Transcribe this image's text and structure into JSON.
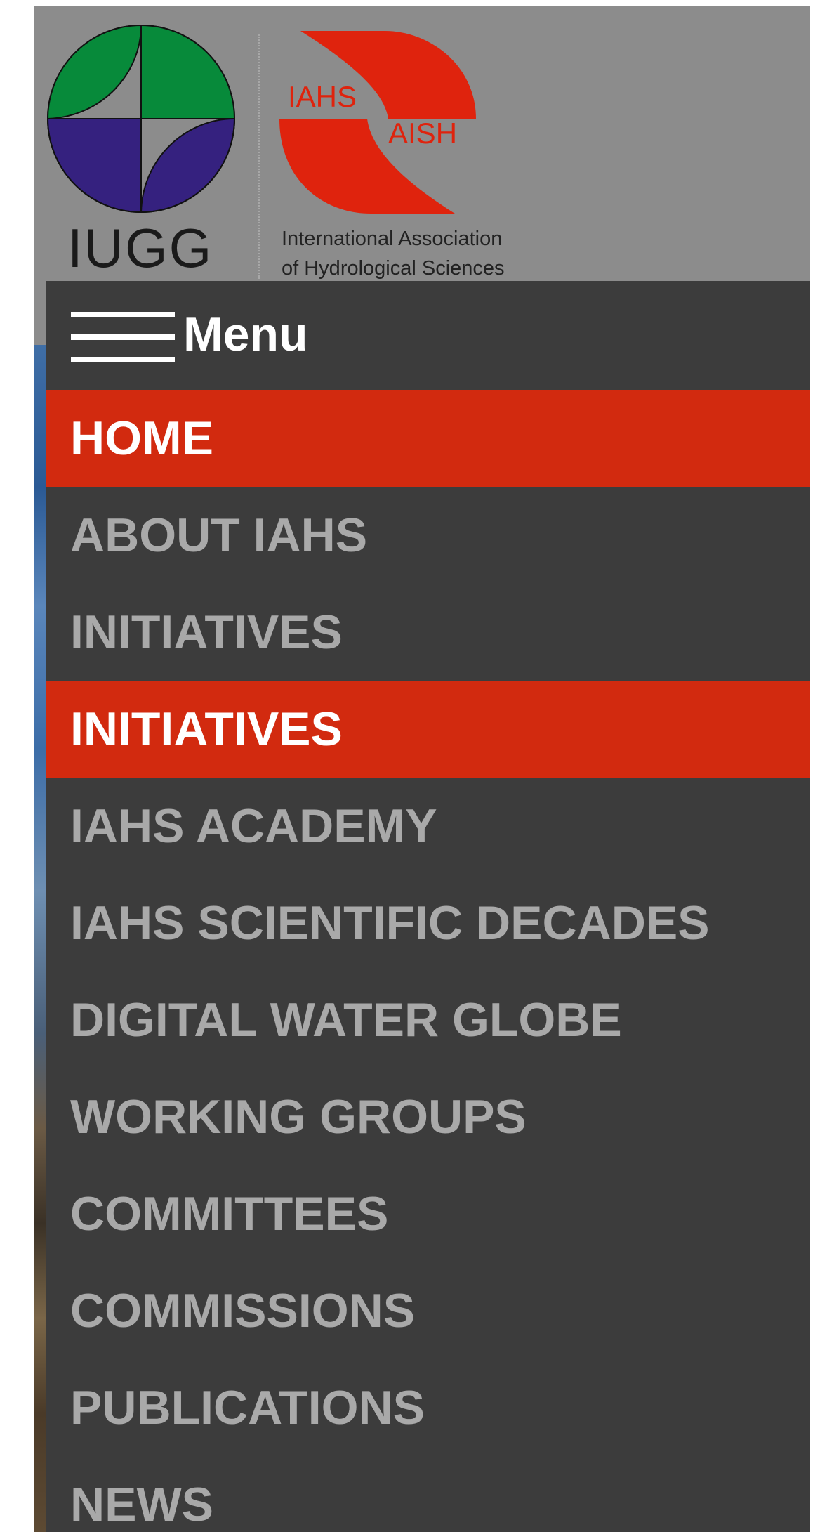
{
  "header": {
    "iugg_label": "IUGG",
    "iahs_logo_text_1": "IAHS",
    "iahs_logo_text_2": "AISH",
    "iahs_caption_line1": "International Association",
    "iahs_caption_line2": "of Hydrological Sciences"
  },
  "menu": {
    "toggle_label": "Menu",
    "items": [
      {
        "label": "HOME",
        "active": true
      },
      {
        "label": "ABOUT IAHS",
        "active": false
      },
      {
        "label": "INITIATIVES",
        "active": false
      },
      {
        "label": "INITIATIVES",
        "active": true
      },
      {
        "label": "IAHS ACADEMY",
        "active": false
      },
      {
        "label": "IAHS SCIENTIFIC DECADES",
        "active": false
      },
      {
        "label": "DIGITAL WATER GLOBE",
        "active": false
      },
      {
        "label": "WORKING GROUPS",
        "active": false
      },
      {
        "label": "COMMITTEES",
        "active": false
      },
      {
        "label": "COMMISSIONS",
        "active": false
      },
      {
        "label": "PUBLICATIONS",
        "active": false
      },
      {
        "label": "NEWS",
        "active": false
      }
    ]
  },
  "colors": {
    "header_bg": "#8c8c8c",
    "menu_bg": "#3c3c3c",
    "active_bg": "#d22a0f",
    "inactive_text": "#a9a9a9",
    "active_text": "#ffffff",
    "iugg_green": "#078a3a",
    "iugg_purple": "#35217f",
    "iahs_red": "#df230d"
  },
  "icons": {
    "menu_toggle": "hamburger-icon",
    "iugg": "iugg-logo",
    "iahs": "iahs-logo"
  }
}
